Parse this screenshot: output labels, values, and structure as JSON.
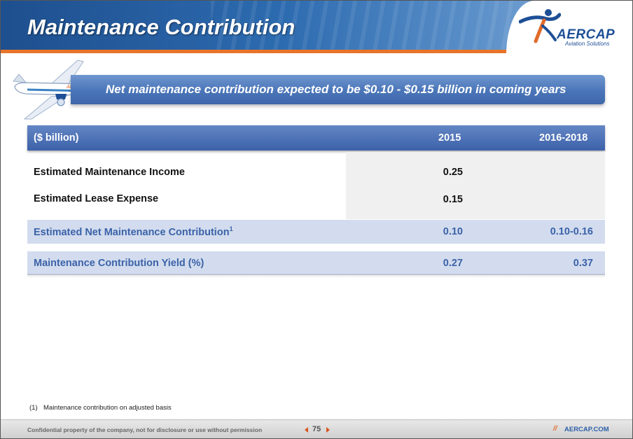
{
  "header": {
    "title": "Maintenance Contribution"
  },
  "logo": {
    "name": "AERCAP",
    "tagline": "Aviation Solutions"
  },
  "banner": {
    "text": "Net maintenance contribution expected to be $0.10 - $0.15 billion in coming years"
  },
  "table": {
    "columns": [
      "($ billion)",
      "2015",
      "2016-2018"
    ],
    "rows": [
      {
        "label": "Estimated Maintenance Income",
        "v2015": "0.25",
        "v2016": ""
      },
      {
        "label": "Estimated Lease Expense",
        "v2015": "0.15",
        "v2016": ""
      },
      {
        "label": "Estimated Net Maintenance Contribution",
        "sup": "1",
        "v2015": "0.10",
        "v2016": "0.10-0.16"
      },
      {
        "label": "Maintenance Contribution Yield (%)",
        "v2015": "0.27",
        "v2016": "0.37"
      }
    ]
  },
  "footnote": {
    "number": "(1)",
    "text": "Maintenance contribution on adjusted basis"
  },
  "footer": {
    "confidential": "Confidential property of the company, not for disclosure or use without permission",
    "page": "75",
    "slashes": "//",
    "site": "AERCAP.COM"
  },
  "colors": {
    "header_blue": "#2d6bb0",
    "accent_orange": "#e8742a",
    "table_blue": "#3d62a9",
    "highlight_row": "#d2dcee"
  }
}
